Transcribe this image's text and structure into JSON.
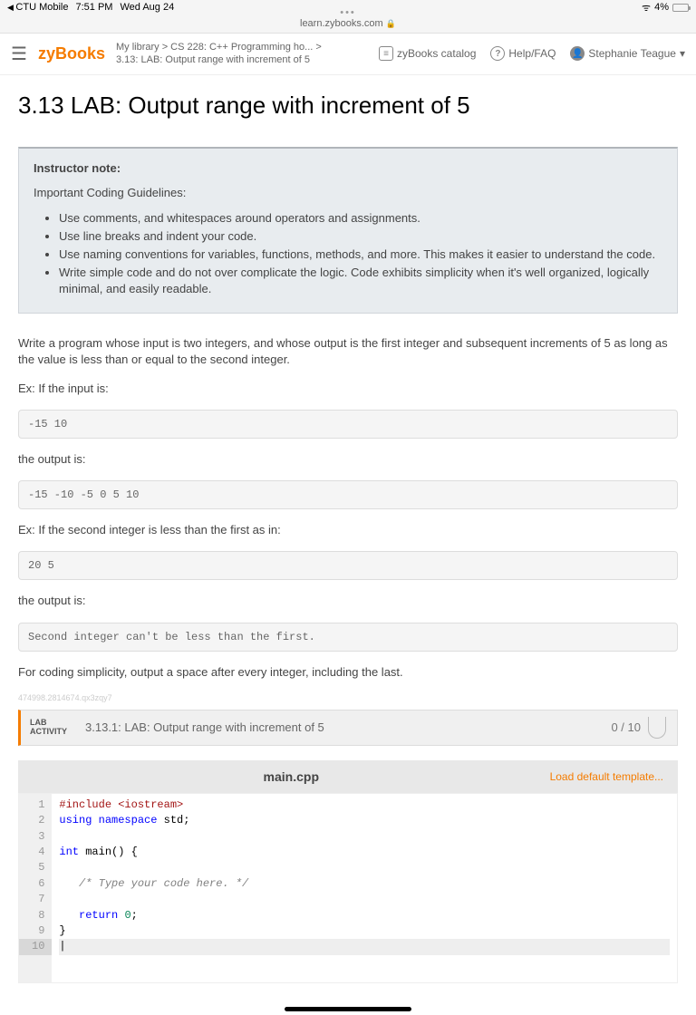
{
  "status": {
    "app": "CTU Mobile",
    "time": "7:51 PM",
    "date": "Wed Aug 24",
    "battery": "4%"
  },
  "url": "learn.zybooks.com",
  "nav": {
    "logo": "zyBooks",
    "breadcrumb_top": "My library > CS 228: C++ Programming ho...  >",
    "breadcrumb_sub": "3.13: LAB: Output range with increment of 5",
    "catalog": "zyBooks catalog",
    "help": "Help/FAQ",
    "user": "Stephanie Teague"
  },
  "page_title": "3.13 LAB: Output range with increment of 5",
  "note": {
    "title": "Instructor note:",
    "subtitle": "Important Coding Guidelines:",
    "items": [
      "Use comments, and whitespaces around operators and assignments.",
      "Use line breaks and indent your code.",
      "Use naming conventions for variables, functions, methods, and more. This makes it easier to understand the code.",
      "Write simple code and do not over complicate the logic. Code exhibits simplicity when it's well organized, logically minimal, and easily readable."
    ]
  },
  "prose": {
    "intro": "Write a program whose input is two integers, and whose output is the first integer and subsequent increments of 5 as long as the value is less than or equal to the second integer.",
    "ex1_label": "Ex: If the input is:",
    "ex1_in": "-15 10",
    "ex1_out_label": "the output is:",
    "ex1_out": "-15 -10 -5 0 5 10",
    "ex2_label": "Ex: If the second integer is less than the first as in:",
    "ex2_in": "20 5",
    "ex2_out_label": "the output is:",
    "ex2_out": "Second integer can't be less than the first.",
    "footer": "For coding simplicity, output a space after every integer, including the last.",
    "watermark": "474998.2814674.qx3zqy7"
  },
  "lab": {
    "label1": "LAB",
    "label2": "ACTIVITY",
    "title": "3.13.1: LAB: Output range with increment of 5",
    "score": "0 / 10"
  },
  "editor": {
    "filename": "main.cpp",
    "load_template": "Load default template..."
  }
}
